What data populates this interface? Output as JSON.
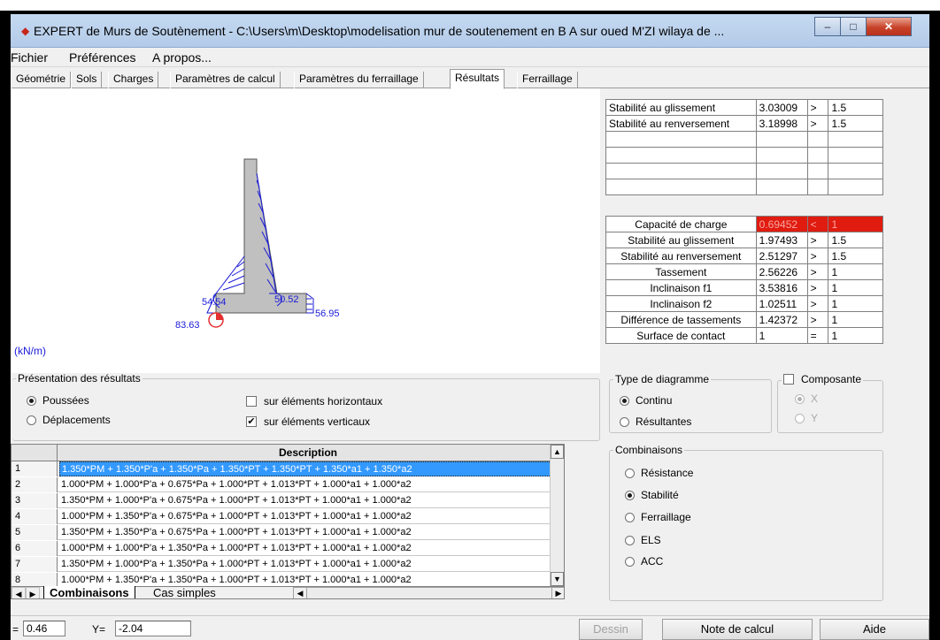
{
  "window": {
    "app_icon": "app-logo-icon",
    "title": "EXPERT de Murs de Soutènement - C:\\Users\\m\\Desktop\\modelisation mur de soutenement en B A sur oued M'ZI wilaya de ...",
    "minimize": "–",
    "maximize": "□",
    "close": "✕"
  },
  "menu": [
    "Fichier",
    "Préférences",
    "A propos..."
  ],
  "tabs": [
    "Géométrie",
    "Sols",
    "Charges",
    "Paramètres de calcul",
    "Paramètres du ferraillage",
    "Résultats",
    "Ferraillage"
  ],
  "active_tab": "Résultats",
  "diagram": {
    "labels": {
      "left_heel": "83.63",
      "left_stem": "54.54",
      "right_stem": "50.52",
      "right_toe": "56.95"
    },
    "unit": "(kN/m)",
    "wall_color": "#c0c0c0",
    "pressure_color": "#1a1ad8"
  },
  "stability_table": [
    {
      "label": "Stabilité au glissement",
      "value": "3.03009",
      "op": ">",
      "threshold": "1.5"
    },
    {
      "label": "Stabilité au renversement",
      "value": "3.18998",
      "op": ">",
      "threshold": "1.5"
    },
    {
      "label": "",
      "value": "",
      "op": "",
      "threshold": ""
    },
    {
      "label": "",
      "value": "",
      "op": "",
      "threshold": ""
    },
    {
      "label": "",
      "value": "",
      "op": "",
      "threshold": ""
    },
    {
      "label": "",
      "value": "",
      "op": "",
      "threshold": ""
    }
  ],
  "checks_table": [
    {
      "label": "Capacité de charge",
      "value": "0.69452",
      "op": "<",
      "threshold": "1",
      "alert": true
    },
    {
      "label": "Stabilité au glissement",
      "value": "1.97493",
      "op": ">",
      "threshold": "1.5",
      "alert": false
    },
    {
      "label": "Stabilité au renversement",
      "value": "2.51297",
      "op": ">",
      "threshold": "1.5",
      "alert": false
    },
    {
      "label": "Tassement",
      "value": "2.56226",
      "op": ">",
      "threshold": "1",
      "alert": false
    },
    {
      "label": "Inclinaison f1",
      "value": "3.53816",
      "op": ">",
      "threshold": "1",
      "alert": false
    },
    {
      "label": "Inclinaison f2",
      "value": "1.02511",
      "op": ">",
      "threshold": "1",
      "alert": false
    },
    {
      "label": "Différence de tassements",
      "value": "1.42372",
      "op": ">",
      "threshold": "1",
      "alert": false
    },
    {
      "label": "Surface de contact",
      "value": "1",
      "op": "=",
      "threshold": "1",
      "alert": false
    }
  ],
  "presentation": {
    "legend": "Présentation des résultats",
    "poussees": "Poussées",
    "deplacements": "Déplacements",
    "horizontaux": "sur éléments horizontaux",
    "verticaux": "sur éléments verticaux",
    "selected": "Poussées",
    "horizontaux_checked": false,
    "verticaux_checked": true
  },
  "diagram_type": {
    "legend": "Type de diagramme",
    "continu": "Continu",
    "resultantes": "Résultantes",
    "selected": "Continu"
  },
  "composante": {
    "legend": "Composante",
    "x": "X",
    "y": "Y",
    "checked": false
  },
  "combinaisons": {
    "legend": "Combinaisons",
    "options": [
      "Résistance",
      "Stabilité",
      "Ferraillage",
      "ELS",
      "ACC"
    ],
    "selected": "Stabilité"
  },
  "grid": {
    "header": "Description",
    "rows": [
      {
        "n": "1",
        "text": "1.350*PM + 1.350*P'a + 1.350*Pa + 1.350*PT + 1.350*PT + 1.350*a1 + 1.350*a2",
        "selected": true
      },
      {
        "n": "2",
        "text": "1.000*PM + 1.000*P'a + 0.675*Pa + 1.000*PT + 1.013*PT + 1.000*a1 + 1.000*a2",
        "selected": false
      },
      {
        "n": "3",
        "text": "1.350*PM + 1.000*P'a + 0.675*Pa + 1.000*PT + 1.013*PT + 1.000*a1 + 1.000*a2",
        "selected": false
      },
      {
        "n": "4",
        "text": "1.000*PM + 1.350*P'a + 0.675*Pa + 1.000*PT + 1.013*PT + 1.000*a1 + 1.000*a2",
        "selected": false
      },
      {
        "n": "5",
        "text": "1.350*PM + 1.350*P'a + 0.675*Pa + 1.000*PT + 1.013*PT + 1.000*a1 + 1.000*a2",
        "selected": false
      },
      {
        "n": "6",
        "text": "1.000*PM + 1.000*P'a + 1.350*Pa + 1.000*PT + 1.013*PT + 1.000*a1 + 1.000*a2",
        "selected": false
      },
      {
        "n": "7",
        "text": "1.350*PM + 1.000*P'a + 1.350*Pa + 1.000*PT + 1.013*PT + 1.000*a1 + 1.000*a2",
        "selected": false
      },
      {
        "n": "8",
        "text": "1.000*PM + 1.350*P'a + 1.350*Pa + 1.000*PT + 1.013*PT + 1.000*a1 + 1.000*a2",
        "selected": false
      }
    ],
    "tabs": [
      "Combinaisons",
      "Cas simples"
    ]
  },
  "status": {
    "x_label": "=",
    "x_value": "0.46",
    "y_label": "Y=",
    "y_value": "-2.04",
    "dessin": "Dessin",
    "note": "Note de calcul",
    "aide": "Aide"
  }
}
